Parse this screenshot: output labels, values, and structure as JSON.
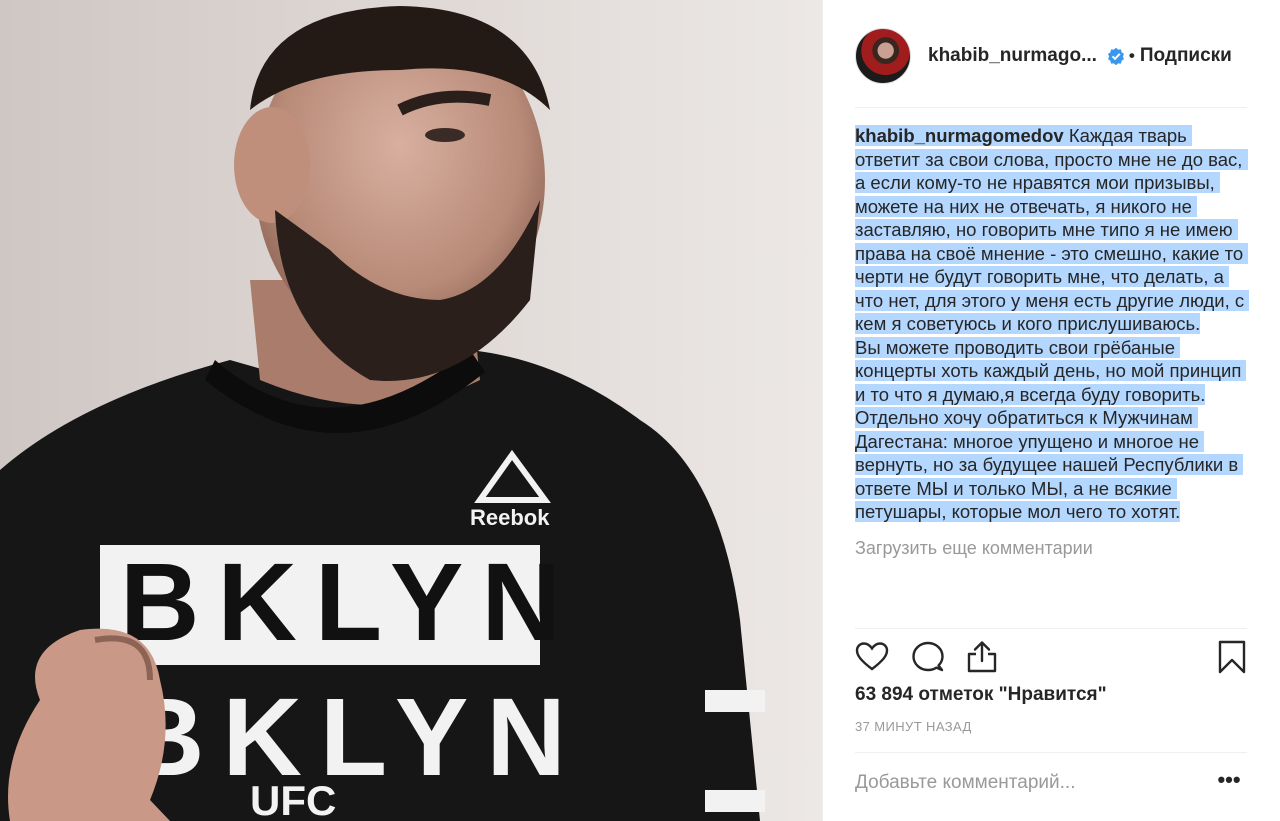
{
  "post": {
    "username": "khabib_nurmago...",
    "follow_label": "Подписки",
    "dot": "•",
    "caption_author": "khabib_nurmagomedov",
    "caption_text": " Каждая тварь ответит за свои слова, просто мне не до вас, а если кому-то не нравятся мои призывы, можете на них не отвечать, я никого не заставляю, но говорить мне типо я не имею права на своё мнение - это смешно, какие то черти не будут говорить мне, что делать, а что нет, для этого у меня есть другие люди, с кем я советуюсь и кого прислушиваюсь.\nВы можете проводить свои грёбаные концерты хоть каждый день, но мой принцип и то что я думаю,я всегда буду говорить.\nОтдельно хочу обратиться к Мужчинам Дагестана: многое упущено и многое не вернуть, но за будущее нашей Республики в ответе МЫ и только МЫ, а не всякие петушары, которые мол чего то хотят.",
    "load_more_label": "Загрузить еще комментарии",
    "likes_text": "63 894 отметок \"Нравится\"",
    "time_text": "37 МИНУТ НАЗАД",
    "comment_placeholder": "Добавьте комментарий...",
    "more_label": "•••"
  },
  "photo": {
    "shirt_brand": "Reebok",
    "shirt_text_top": "BKLYN",
    "shirt_text_bottom": "BKLYN",
    "sleeve_text": "UFC"
  },
  "icons": {
    "like": "heart-icon",
    "comment": "comment-icon",
    "share": "share-icon",
    "save": "bookmark-icon",
    "verified": "verified-badge-icon"
  },
  "colors": {
    "selection": "#b3d7fe",
    "verified": "#3897f0",
    "muted": "#999999",
    "text": "#262626"
  }
}
